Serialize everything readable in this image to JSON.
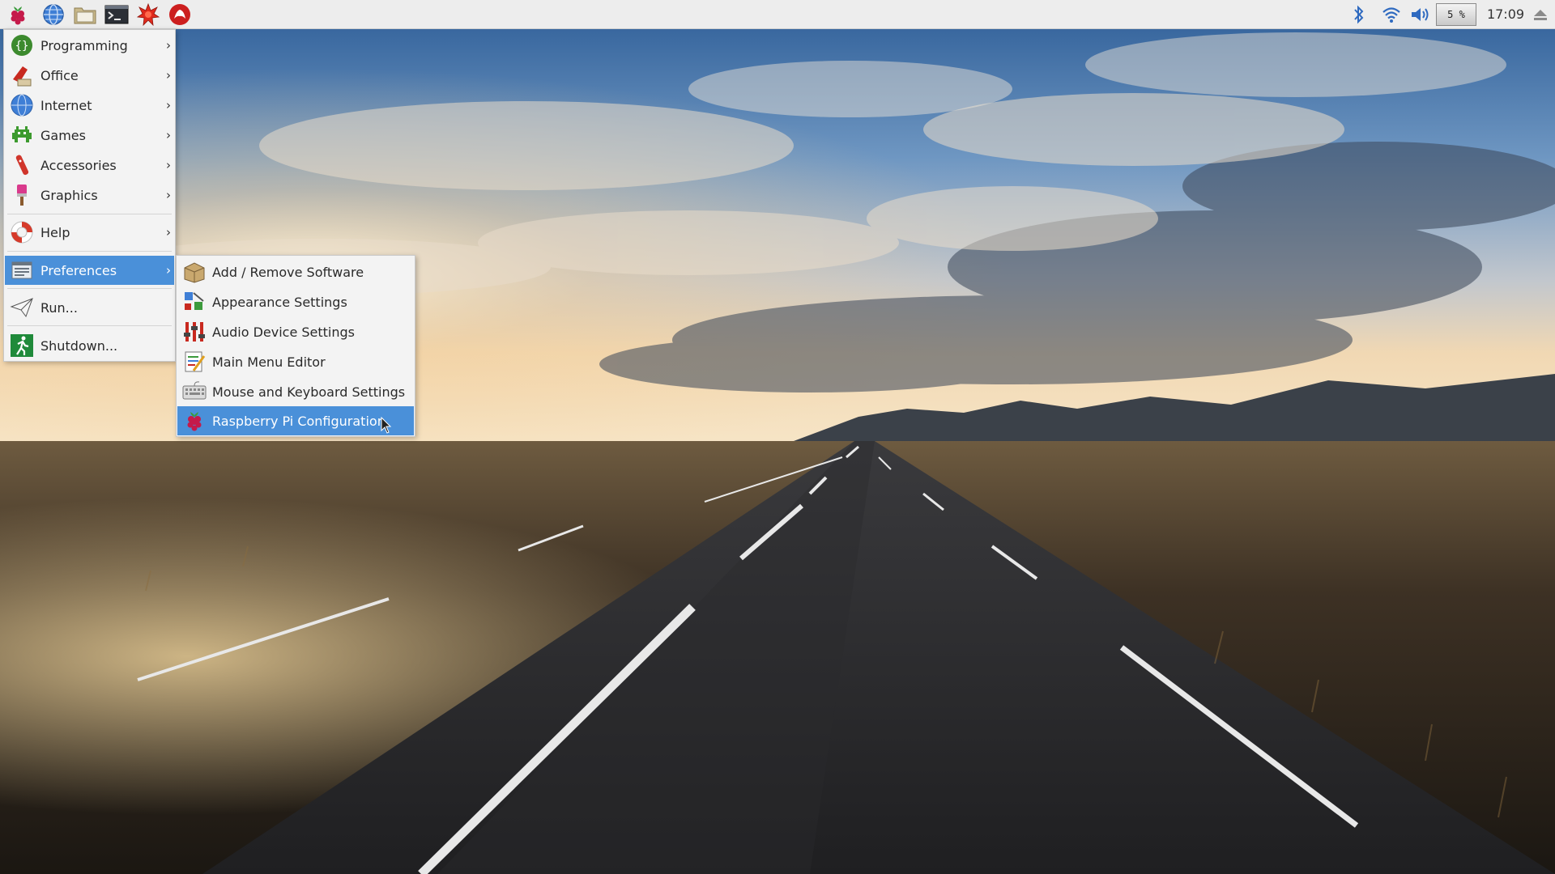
{
  "panel": {
    "launchers": [
      {
        "icon": "raspberry-menu-icon"
      },
      {
        "icon": "web-browser-globe-icon"
      },
      {
        "icon": "file-manager-folder-icon"
      },
      {
        "icon": "terminal-icon"
      },
      {
        "icon": "mathematica-star-icon"
      },
      {
        "icon": "wolfram-icon"
      }
    ],
    "tray": {
      "bluetooth_icon": "bluetooth-icon",
      "wifi_icon": "wifi-icon",
      "volume_icon": "volume-icon",
      "cpu_usage": "5 %",
      "clock": "17:09",
      "eject_icon": "eject-icon"
    }
  },
  "menu": {
    "items": [
      {
        "label": "Programming",
        "icon": "programming-icon",
        "has_submenu": true
      },
      {
        "label": "Office",
        "icon": "office-icon",
        "has_submenu": true
      },
      {
        "label": "Internet",
        "icon": "internet-globe-icon",
        "has_submenu": true
      },
      {
        "label": "Games",
        "icon": "games-invader-icon",
        "has_submenu": true
      },
      {
        "label": "Accessories",
        "icon": "accessories-knife-icon",
        "has_submenu": true
      },
      {
        "label": "Graphics",
        "icon": "graphics-brush-icon",
        "has_submenu": true
      },
      {
        "label": "Help",
        "icon": "help-lifebuoy-icon",
        "has_submenu": true
      },
      {
        "label": "Preferences",
        "icon": "preferences-icon",
        "has_submenu": true,
        "selected": true
      },
      {
        "label": "Run...",
        "icon": "run-paperplane-icon",
        "has_submenu": false
      },
      {
        "label": "Shutdown...",
        "icon": "shutdown-exit-icon",
        "has_submenu": false
      }
    ],
    "arrow": "›"
  },
  "submenu": {
    "items": [
      {
        "label": "Add / Remove Software",
        "icon": "package-icon"
      },
      {
        "label": "Appearance Settings",
        "icon": "appearance-icon"
      },
      {
        "label": "Audio Device Settings",
        "icon": "audio-mixer-icon"
      },
      {
        "label": "Main Menu Editor",
        "icon": "menu-editor-icon"
      },
      {
        "label": "Mouse and Keyboard Settings",
        "icon": "keyboard-icon"
      },
      {
        "label": "Raspberry Pi Configuration",
        "icon": "raspberry-config-icon",
        "selected": true
      }
    ]
  },
  "colors": {
    "selection": "#4a90d9",
    "menu_bg": "#f3f3f3",
    "panel_bg": "#ededed"
  }
}
